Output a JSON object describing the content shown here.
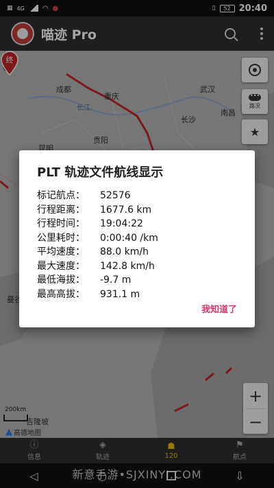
{
  "status_bar": {
    "network": "4G",
    "battery": "52",
    "time": "20:40"
  },
  "app_bar": {
    "title": "喵迹 Pro",
    "icons": [
      "search-icon",
      "more-vert-icon"
    ]
  },
  "map": {
    "end_marker_label": "终",
    "cities": [
      "成都",
      "重庆",
      "武汉",
      "长沙",
      "南昌",
      "贵阳",
      "昆明",
      "曼谷",
      "吉隆坡"
    ],
    "rivers": [
      "长江"
    ],
    "traffic_label": "路况",
    "scale_label": "200km",
    "provider": "高德地图",
    "zoom_in": "+",
    "zoom_out": "−",
    "colors": {
      "track": "#c0262d",
      "land": "#b5b5b5",
      "sea": "#a6a6a6"
    }
  },
  "dialog": {
    "title": "PLT 轨迹文件航线显示",
    "rows": [
      {
        "label": "标记航点：",
        "value": "52576"
      },
      {
        "label": "行程距离：",
        "value": "1677.6 km"
      },
      {
        "label": "行程时间：",
        "value": "19:04:22"
      },
      {
        "label": "公里耗时：",
        "value": "0:00:40 /km"
      },
      {
        "label": "平均速度：",
        "value": "88.0 km/h"
      },
      {
        "label": "最大速度：",
        "value": "142.8 km/h"
      },
      {
        "label": "最低海拔：",
        "value": "-9.7 m"
      },
      {
        "label": "最高高拔：",
        "value": "931.1 m"
      }
    ],
    "action": "我知道了",
    "accent_color": "#d63b6c"
  },
  "bottom_nav": {
    "items": [
      {
        "label": "信息",
        "icon": "info-icon"
      },
      {
        "label": "轨迹",
        "icon": "compass-icon"
      },
      {
        "label": "120",
        "icon": "android-icon",
        "active": true
      },
      {
        "label": "航点",
        "icon": "flag-icon"
      }
    ]
  },
  "watermark": "新意手游•SJXINYI.COM"
}
